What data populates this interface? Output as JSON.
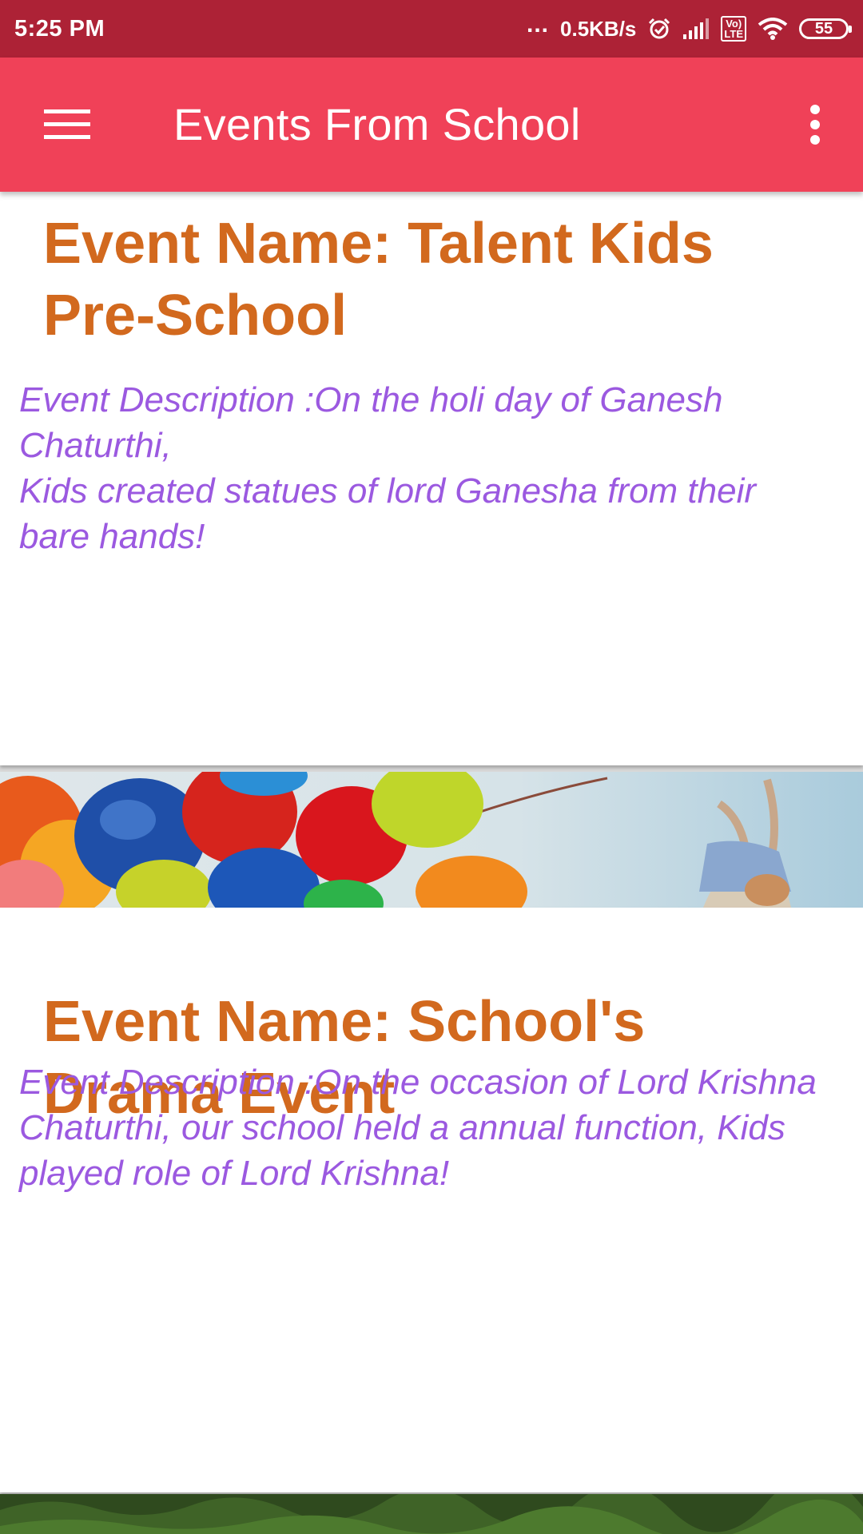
{
  "status_bar": {
    "time": "5:25 PM",
    "dots": "...",
    "speed": "0.5KB/s",
    "lte_top": "Vo)",
    "lte_bottom": "LTE",
    "battery": "55"
  },
  "app_bar": {
    "title": "Events From School",
    "menu_icon": "hamburger-menu-icon",
    "overflow_icon": "more-vert-icon"
  },
  "events": [
    {
      "name": "Event Name: Talent Kids Pre-School",
      "description": "Event Description :On the holi day of Ganesh Chaturthi,\nKids created statues of lord Ganesha from their bare hands!"
    },
    {
      "name": "Event Name: School's Drama Event",
      "description": "Event Description :On the occasion of Lord Krishna Chaturthi, our school held a annual function, Kids played role of Lord Krishna!"
    }
  ],
  "colors": {
    "status_bar": "#ad2236",
    "app_bar": "#f04158",
    "event_name": "#d2691e",
    "event_description": "#9b59e0"
  }
}
